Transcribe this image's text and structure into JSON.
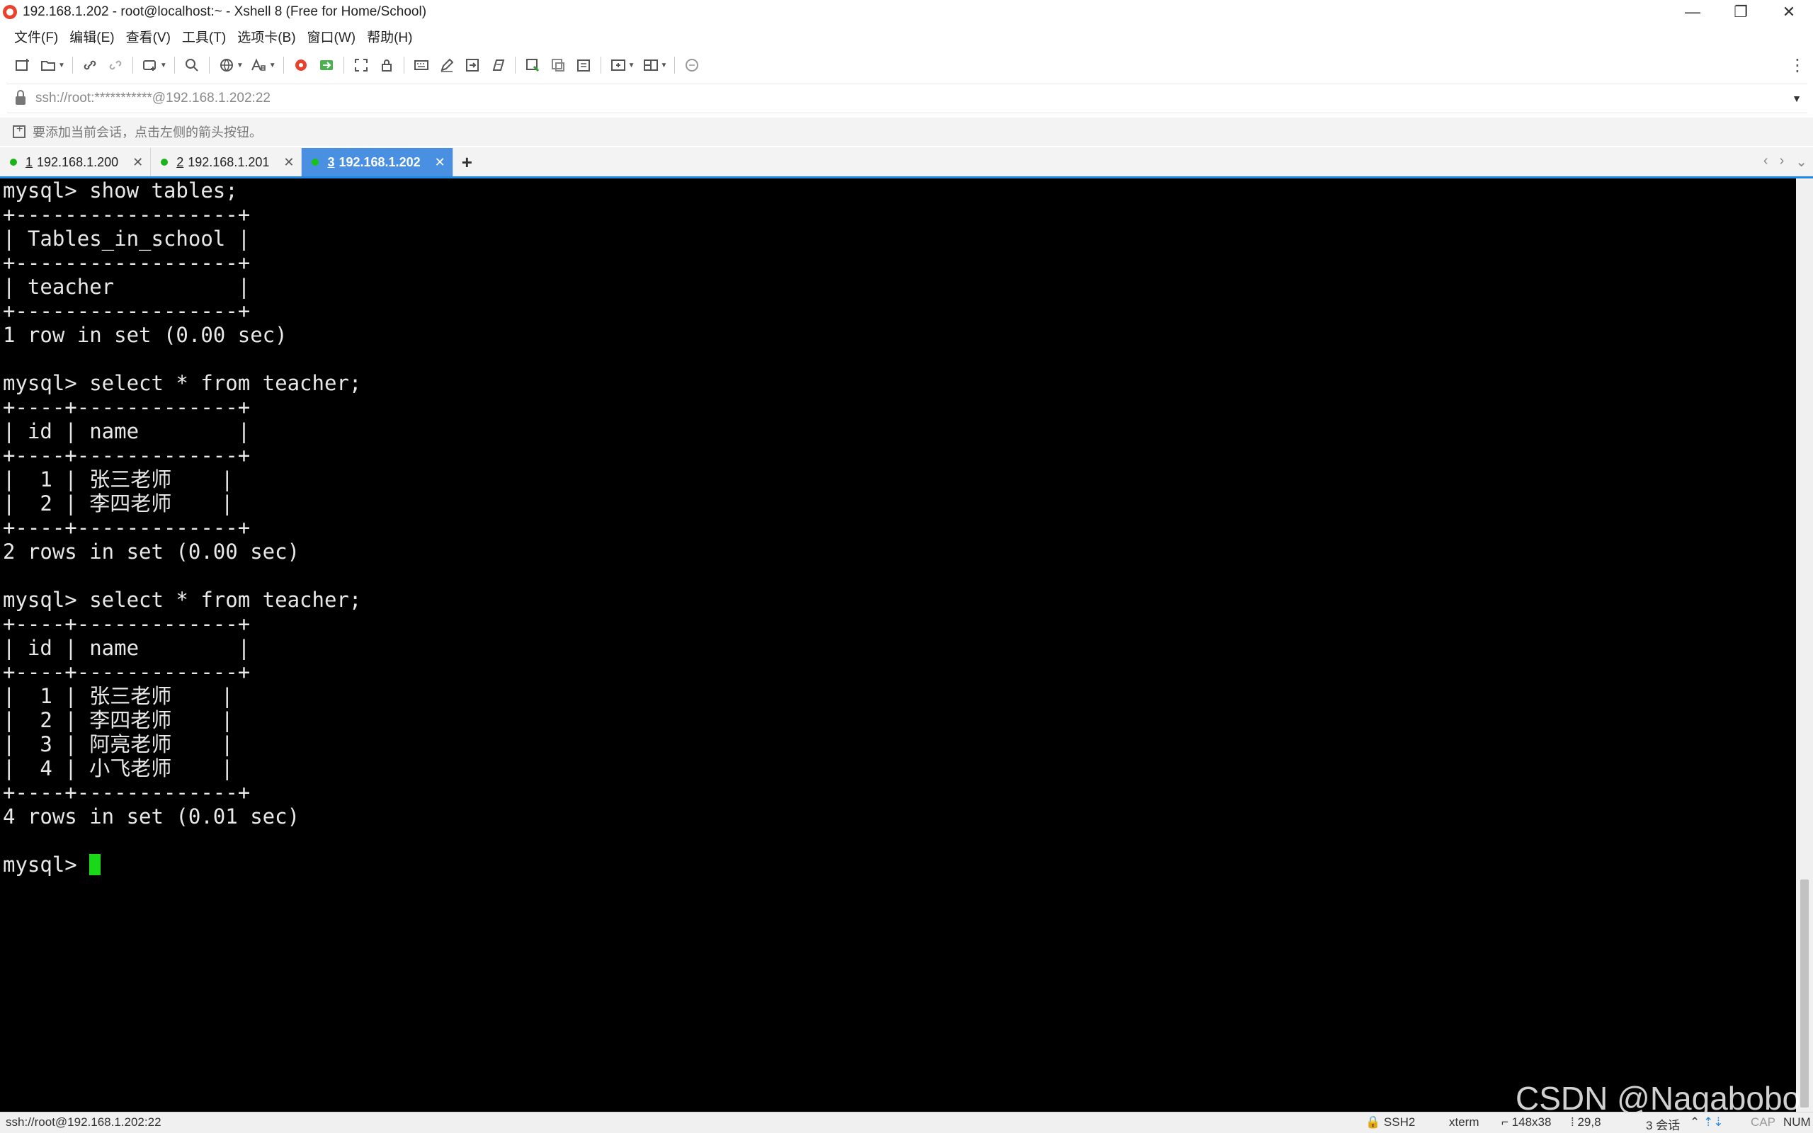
{
  "window": {
    "title": "192.168.1.202 - root@localhost:~ - Xshell 8 (Free for Home/School)",
    "minimize": "—",
    "restore": "❐",
    "close": "✕"
  },
  "menu": [
    "文件(F)",
    "编辑(E)",
    "查看(V)",
    "工具(T)",
    "选项卡(B)",
    "窗口(W)",
    "帮助(H)"
  ],
  "address": {
    "value": "ssh://root:***********@192.168.1.202:22"
  },
  "hint": {
    "text": "要添加当前会话，点击左侧的箭头按钮。"
  },
  "tabs": [
    {
      "num": "1",
      "label": "192.168.1.200",
      "active": false
    },
    {
      "num": "2",
      "label": "192.168.1.201",
      "active": false
    },
    {
      "num": "3",
      "label": "192.168.1.202",
      "active": true
    }
  ],
  "tab_add": "+",
  "tab_nav": {
    "prev": "‹",
    "next": "›",
    "menu": "⌄"
  },
  "terminal": {
    "lines": [
      "mysql> show tables;",
      "+------------------+",
      "| Tables_in_school |",
      "+------------------+",
      "| teacher          |",
      "+------------------+",
      "1 row in set (0.00 sec)",
      "",
      "mysql> select * from teacher;",
      "+----+-------------+",
      "| id | name        |",
      "+----+-------------+",
      "|  1 | 张三老师    |",
      "|  2 | 李四老师    |",
      "+----+-------------+",
      "2 rows in set (0.00 sec)",
      "",
      "mysql> select * from teacher;",
      "+----+-------------+",
      "| id | name        |",
      "+----+-------------+",
      "|  1 | 张三老师    |",
      "|  2 | 李四老师    |",
      "|  3 | 阿亮老师    |",
      "|  4 | 小飞老师    |",
      "+----+-------------+",
      "4 rows in set (0.01 sec)",
      "",
      "mysql> "
    ]
  },
  "watermark": "CSDN @Nagabobo",
  "status": {
    "connection": "ssh://root@192.168.1.202:22",
    "protocol": "SSH2",
    "terminal_type": "xterm",
    "size": "148x38",
    "cursor_pos": "29,8",
    "sessions": "3 会话",
    "cap": "CAP",
    "num": "NUM"
  },
  "icons": {
    "app": "xshell-logo-icon",
    "toolbar": [
      "new-session-icon",
      "open-folder-icon",
      "link-icon",
      "unlink-icon",
      "new-window-icon",
      "search-icon",
      "globe-icon",
      "font-icon",
      "xftp-icon",
      "transfer-icon",
      "fullscreen-icon",
      "lock-icon",
      "keyboard-icon",
      "compose-icon",
      "script-icon",
      "macro-icon",
      "log-icon",
      "copy-icon",
      "paste-icon",
      "new-tab-icon",
      "layout-icon",
      "chat-icon"
    ]
  }
}
